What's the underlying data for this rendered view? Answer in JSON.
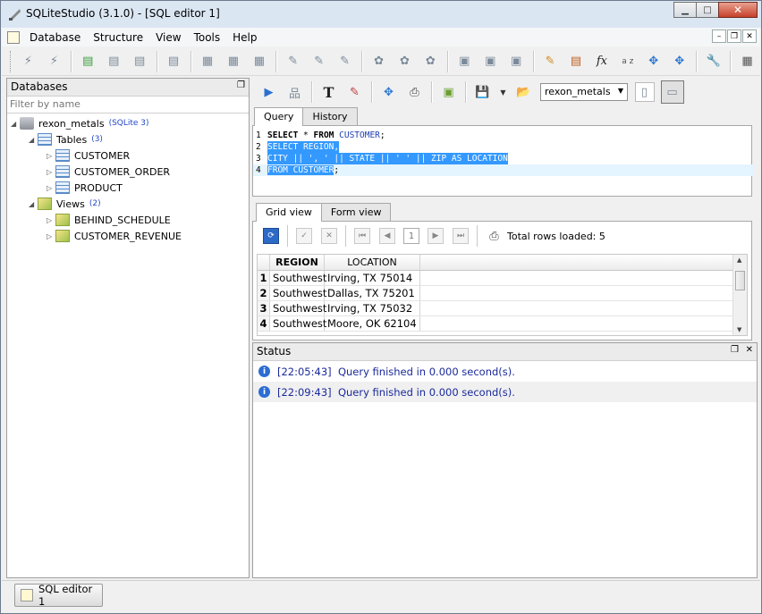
{
  "window": {
    "title": "SQLiteStudio (3.1.0) - [SQL editor 1]"
  },
  "menu": [
    "Database",
    "Structure",
    "View",
    "Tools",
    "Help"
  ],
  "databases_panel": {
    "title": "Databases",
    "filter_placeholder": "Filter by name",
    "db_name": "rexon_metals",
    "db_version": "(SQLite 3)",
    "tables_label": "Tables",
    "tables_count": "(3)",
    "tables": [
      "CUSTOMER",
      "CUSTOMER_ORDER",
      "PRODUCT"
    ],
    "views_label": "Views",
    "views_count": "(2)",
    "views": [
      "BEHIND_SCHEDULE",
      "CUSTOMER_REVENUE"
    ]
  },
  "editor": {
    "db_combo": "rexon_metals",
    "tabs": [
      "Query",
      "History"
    ],
    "lines": [
      {
        "num": "1",
        "text": "SELECT * FROM CUSTOMER;"
      },
      {
        "num": "2",
        "text": "SELECT REGION,"
      },
      {
        "num": "3",
        "text": "CITY || ', ' || STATE || ' ' || ZIP AS LOCATION"
      },
      {
        "num": "4",
        "text": "FROM CUSTOMER;"
      }
    ]
  },
  "results": {
    "tabs": [
      "Grid view",
      "Form view"
    ],
    "page": "1",
    "total_rows": "Total rows loaded: 5",
    "columns": [
      "REGION",
      "LOCATION"
    ],
    "rows": [
      {
        "n": "1",
        "region": "Southwest",
        "location": "Irving, TX 75014"
      },
      {
        "n": "2",
        "region": "Southwest",
        "location": "Dallas, TX 75201"
      },
      {
        "n": "3",
        "region": "Southwest",
        "location": "Irving, TX 75032"
      },
      {
        "n": "4",
        "region": "Southwest",
        "location": "Moore, OK 62104"
      }
    ]
  },
  "status": {
    "title": "Status",
    "messages": [
      {
        "time": "[22:05:43]",
        "text": "Query finished in 0.000 second(s)."
      },
      {
        "time": "[22:09:43]",
        "text": "Query finished in 0.000 second(s)."
      }
    ]
  },
  "taskbar": {
    "editor_button": "SQL editor 1"
  }
}
